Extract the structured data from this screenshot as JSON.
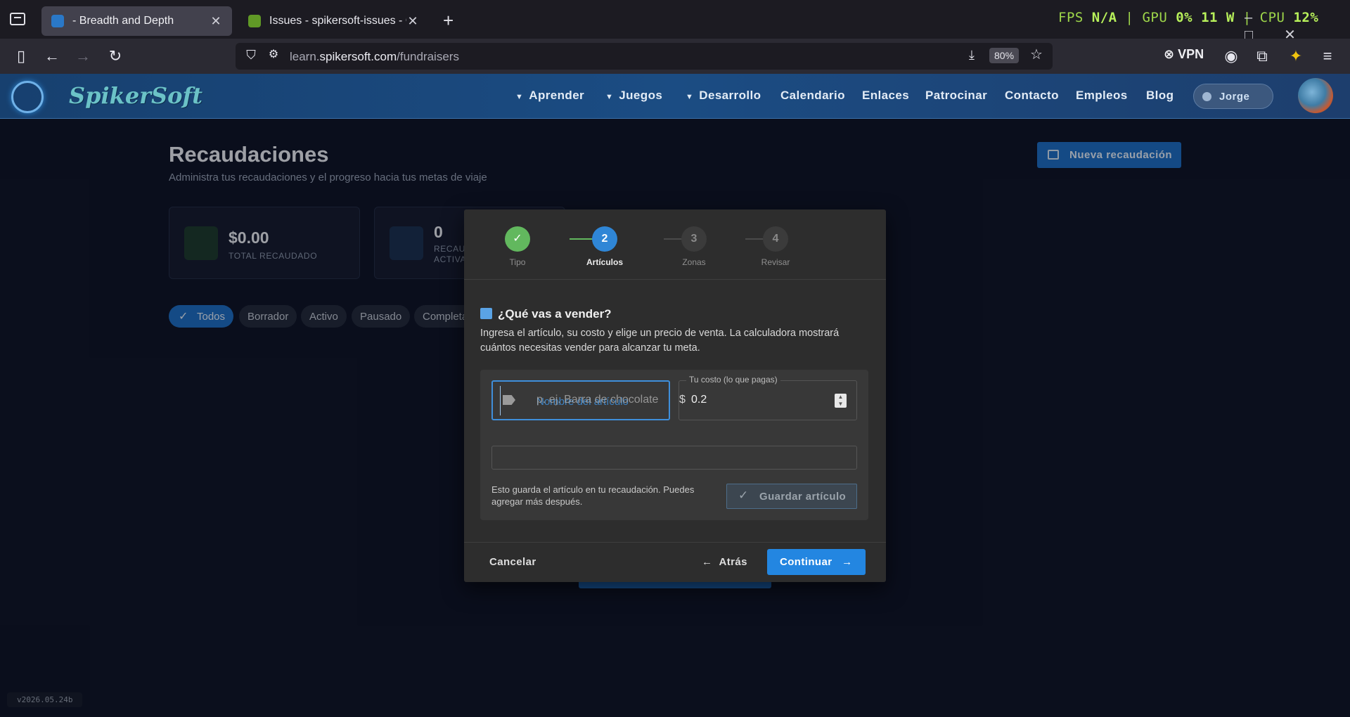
{
  "browser": {
    "tabs": [
      {
        "title": "- Breadth and Depth",
        "close": "✕"
      },
      {
        "title": "Issues - spikersoft-issues - Gitea",
        "close": "✕"
      }
    ],
    "new_tab": "+",
    "url_host": "learn.",
    "url_domain": "spikersoft.com",
    "url_path": "/fundraisers",
    "zoom": "80%",
    "vpn": "VPN",
    "perf": {
      "fps_label": "FPS",
      "fps_value": "N/A",
      "gpu_label": "GPU",
      "gpu_value": "0%",
      "watts": "11 W",
      "cpu_label": "CPU",
      "cpu_value": "12%"
    }
  },
  "site": {
    "logo": "SpikerSoft",
    "menu": [
      "Aprender",
      "Juegos",
      "Desarrollo",
      "Calendario",
      "Enlaces",
      "Patrocinar",
      "Contacto",
      "Empleos",
      "Blog"
    ],
    "user": "Jorge"
  },
  "page": {
    "title": "Recaudaciones",
    "subtitle": "Administra tus recaudaciones y el progreso hacia tus metas de viaje",
    "new_button": "Nueva recaudación",
    "stats": [
      {
        "value": "$0.00",
        "label": "TOTAL RECAUDADO"
      },
      {
        "value": "0",
        "label": "RECAUDACIONES ACTIVAS"
      }
    ],
    "filters": [
      "Todos",
      "Borrador",
      "Activo",
      "Pausado",
      "Completado"
    ]
  },
  "modal": {
    "steps": [
      {
        "num": "✓",
        "label": "Tipo",
        "state": "done"
      },
      {
        "num": "2",
        "label": "Artículos",
        "state": "current"
      },
      {
        "num": "3",
        "label": "Zonas",
        "state": "todo"
      },
      {
        "num": "4",
        "label": "Revisar",
        "state": "todo"
      }
    ],
    "question": "¿Qué vas a vender?",
    "description": "Ingresa el artículo, su costo y elige un precio de venta. La calculadora mostrará cuántos necesitas vender para alcanzar tu meta.",
    "name_field": {
      "label": "Nombre del artículo",
      "placeholder": "p. ej. Barra de chocolate"
    },
    "cost_field": {
      "label": "Tu costo (lo que pagas)",
      "currency": "$",
      "value": "0.2"
    },
    "save_note": "Esto guarda el artículo en tu recaudación. Puedes agregar más después.",
    "save_button": "Guardar artículo",
    "cancel": "Cancelar",
    "back": "Atrás",
    "continue": "Continuar"
  },
  "version": "v2026.05.24b",
  "colors": {
    "accent": "#2386e1",
    "done": "#62b85e",
    "header": "#1b4c83"
  }
}
